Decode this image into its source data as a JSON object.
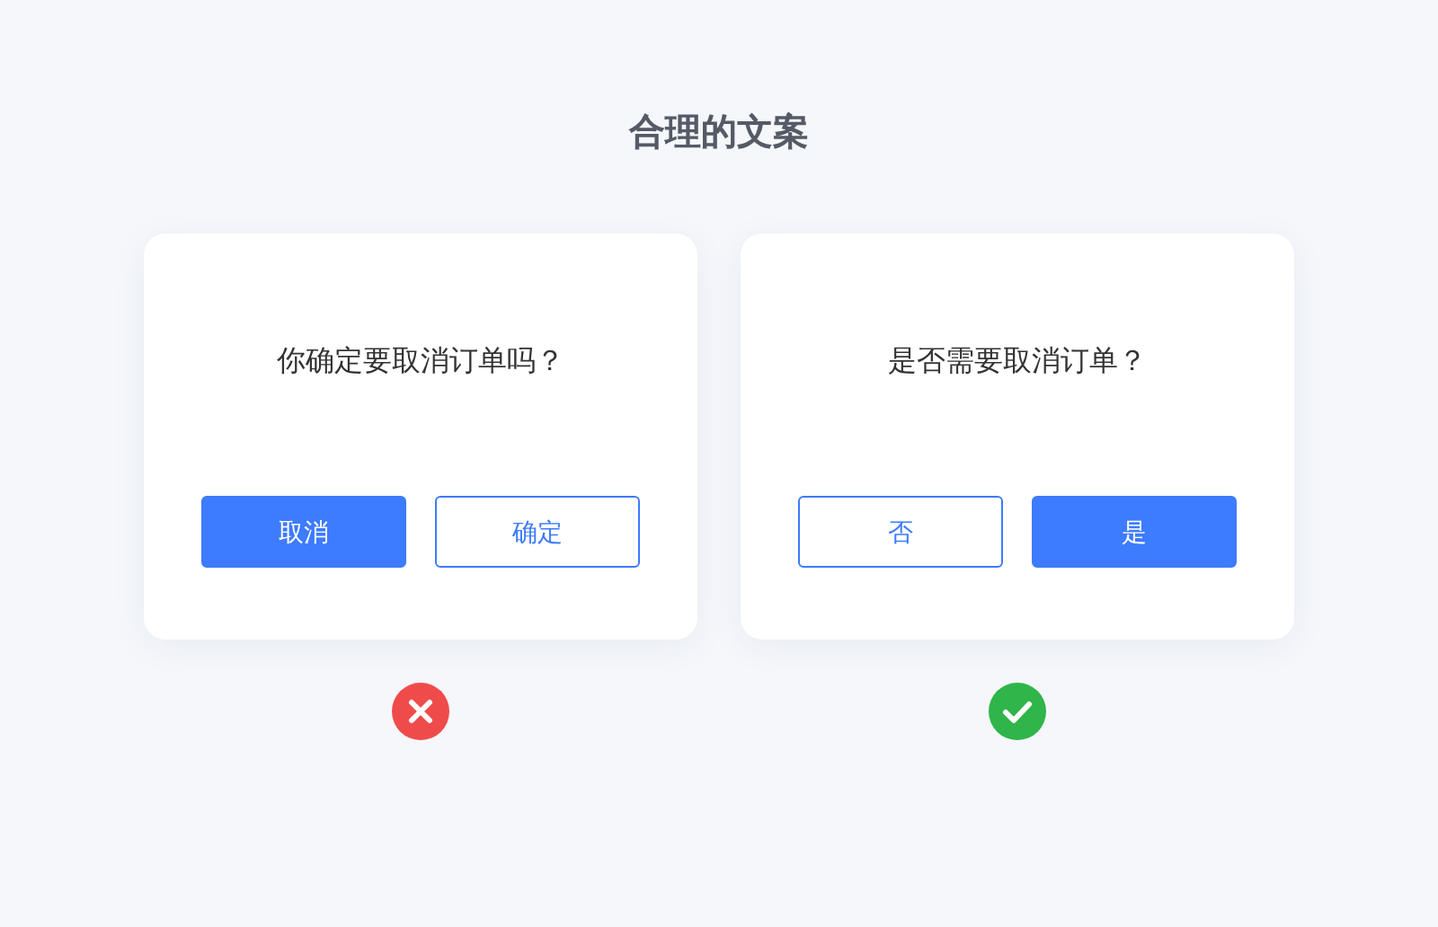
{
  "title": "合理的文案",
  "examples": [
    {
      "question": "你确定要取消订单吗？",
      "buttons": [
        {
          "label": "取消",
          "kind": "primary"
        },
        {
          "label": "确定",
          "kind": "outline"
        }
      ],
      "correct": false
    },
    {
      "question": "是否需要取消订单？",
      "buttons": [
        {
          "label": "否",
          "kind": "outline"
        },
        {
          "label": "是",
          "kind": "primary"
        }
      ],
      "correct": true
    }
  ]
}
